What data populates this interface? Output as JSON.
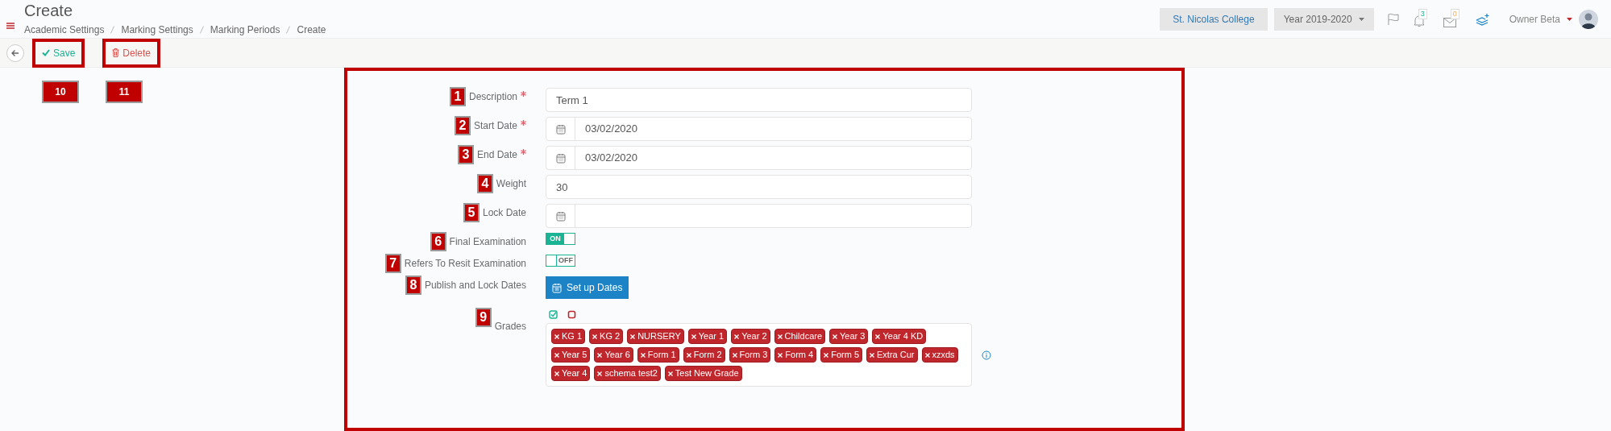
{
  "header": {
    "title": "Create",
    "breadcrumbs": [
      "Academic Settings",
      "Marking Settings",
      "Marking Periods",
      "Create"
    ],
    "school": "St. Nicolas College",
    "year": "Year 2019-2020",
    "notifications": "3",
    "messages": "0",
    "user": "Owner Beta"
  },
  "toolbar": {
    "save": {
      "label": "Save",
      "marker": "10"
    },
    "delete": {
      "label": "Delete",
      "marker": "11"
    }
  },
  "form": [
    {
      "kind": "text",
      "marker": "1",
      "label": "Description",
      "required": true,
      "value": "Term 1"
    },
    {
      "kind": "date",
      "marker": "2",
      "label": "Start Date",
      "required": true,
      "value": "03/02/2020"
    },
    {
      "kind": "date",
      "marker": "3",
      "label": "End Date",
      "required": true,
      "value": "03/02/2020"
    },
    {
      "kind": "text",
      "marker": "4",
      "label": "Weight",
      "required": false,
      "value": "30"
    },
    {
      "kind": "date",
      "marker": "5",
      "label": "Lock Date",
      "required": false
    },
    {
      "kind": "toggle",
      "marker": "6",
      "label": "Final Examination",
      "on": true,
      "state_text": "ON"
    },
    {
      "kind": "toggle",
      "marker": "7",
      "label": "Refers To Resit Examination",
      "on": false,
      "state_text": "OFF"
    },
    {
      "kind": "button",
      "marker": "8",
      "label": "Publish and Lock Dates",
      "button": "Set up Dates"
    },
    {
      "kind": "tags",
      "marker": "9",
      "label": "Grades",
      "tags": [
        "KG 1",
        "KG 2",
        "NURSERY",
        "Year 1",
        "Year 2",
        "Childcare",
        "Year 3",
        "Year 4 KD",
        "Year 5",
        "Year 6",
        "Form 1",
        "Form 2",
        "Form 3",
        "Form 4",
        "Form 5",
        "Extra Cur",
        "xzxds",
        "Year 4",
        "schema test2",
        "Test New Grade"
      ]
    }
  ]
}
